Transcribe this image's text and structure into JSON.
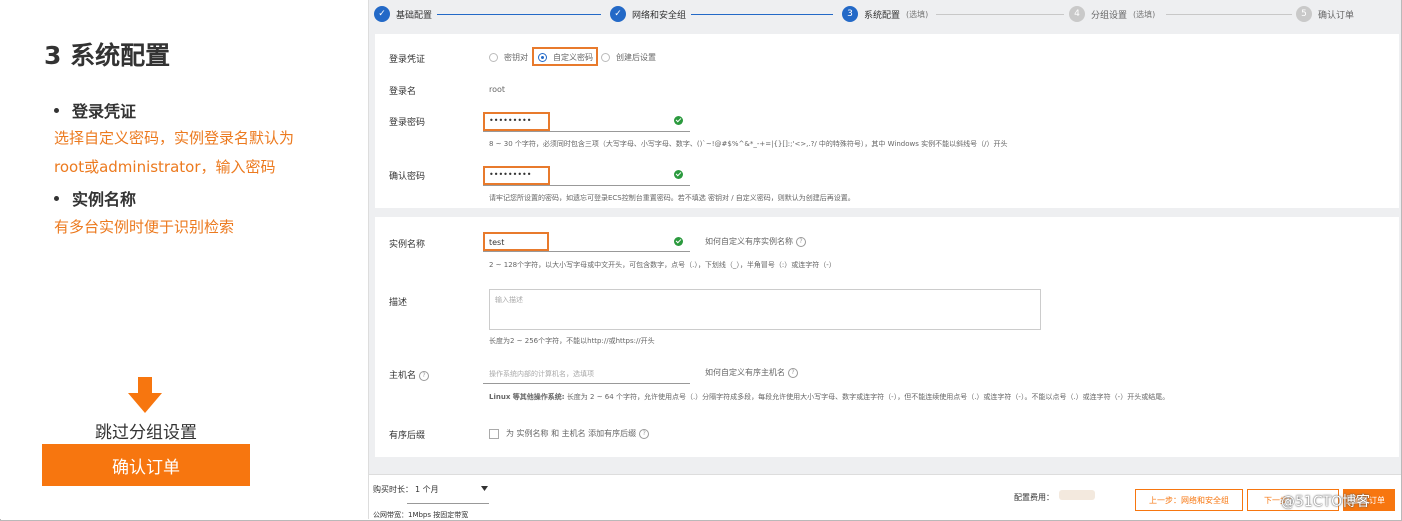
{
  "left": {
    "title": "3 系统配置",
    "bullet1": "登录凭证",
    "desc1_line1": "选择自定义密码，实例登录名默认为",
    "desc1_line2": "root或administrator，输入密码",
    "bullet2": "实例名称",
    "desc2": "有多台实例时便于识别检索",
    "skip_label": "跳过分组设置",
    "confirm_label": "确认订单"
  },
  "steps": [
    {
      "num": "✓",
      "label": "基础配置",
      "optional": ""
    },
    {
      "num": "✓",
      "label": "网络和安全组",
      "optional": ""
    },
    {
      "num": "3",
      "label": "系统配置",
      "optional": "(选填)"
    },
    {
      "num": "4",
      "label": "分组设置",
      "optional": "(选填)"
    },
    {
      "num": "5",
      "label": "确认订单",
      "optional": ""
    }
  ],
  "login": {
    "label": "登录凭证",
    "options": [
      "密钥对",
      "自定义密码",
      "创建后设置"
    ],
    "selected": "自定义密码",
    "username_label": "登录名",
    "username_value": "root",
    "password_label": "登录密码",
    "password_value": "•••••••••",
    "password_hint": "8 ~ 30 个字符，必须同时包含三项（大写字母、小写字母、数字、()`~!@#$%^&*_-+=|{}[]:;'<>,.?/ 中的特殊符号），其中 Windows 实例不能以斜线号（/）开头",
    "confirm_label": "确认密码",
    "confirm_value": "•••••••••",
    "confirm_hint": "请牢记您所设置的密码，如遗忘可登录ECS控制台重置密码。若不填选 密钥对 / 自定义密码，则默认为创建后再设置。"
  },
  "instance": {
    "name_label": "实例名称",
    "name_value": "test",
    "name_help": "如何自定义有序实例名称",
    "name_hint": "2 ~ 128个字符，以大小写字母或中文开头，可包含数字，点号（.），下划线（_），半角冒号（:）或连字符（-）",
    "desc_label": "描述",
    "desc_placeholder": "输入描述",
    "desc_hint": "长度为2 ~ 256个字符，不能以http://或https://开头",
    "host_label": "主机名",
    "host_placeholder": "操作系统内部的计算机名，选填项",
    "host_help": "如何自定义有序主机名",
    "host_hint_bold": "Linux 等其他操作系统:",
    "host_hint": "长度为 2 ~ 64 个字符，允许使用点号（.）分隔字符成多段，每段允许使用大小写字母、数字或连字符（-），但不能连续使用点号（.）或连字符（-）。不能以点号（.）或连字符（-）开头或结尾。",
    "suffix_label": "有序后缀",
    "suffix_check": "为 实例名称 和 主机名 添加有序后缀"
  },
  "footer": {
    "duration_label": "购买时长：",
    "duration_value": "1 个月",
    "bandwidth": "公网带宽：1Mbps 按固定带宽",
    "cost_label": "配置费用：",
    "prev_button": "上一步：网络和安全组",
    "next_button": "下一步：",
    "confirm_button": "确认订单"
  },
  "watermark": "@51CTO博客"
}
